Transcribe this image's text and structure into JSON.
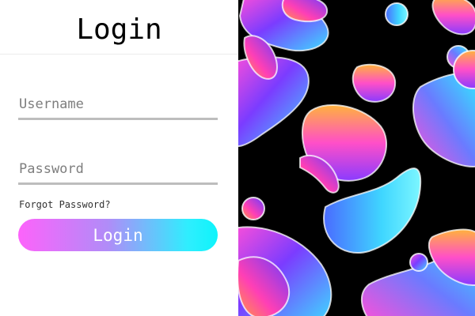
{
  "header": {
    "title": "Login"
  },
  "form": {
    "username": {
      "placeholder": "Username",
      "value": ""
    },
    "password": {
      "placeholder": "Password",
      "value": ""
    },
    "forgot_password": "Forgot Password?",
    "login_label": "Login"
  },
  "colors": {
    "gradient_start": "#fd63fb",
    "gradient_end": "#0ef4fb",
    "input_underline": "#bdbdbd",
    "art_background": "#000000"
  }
}
